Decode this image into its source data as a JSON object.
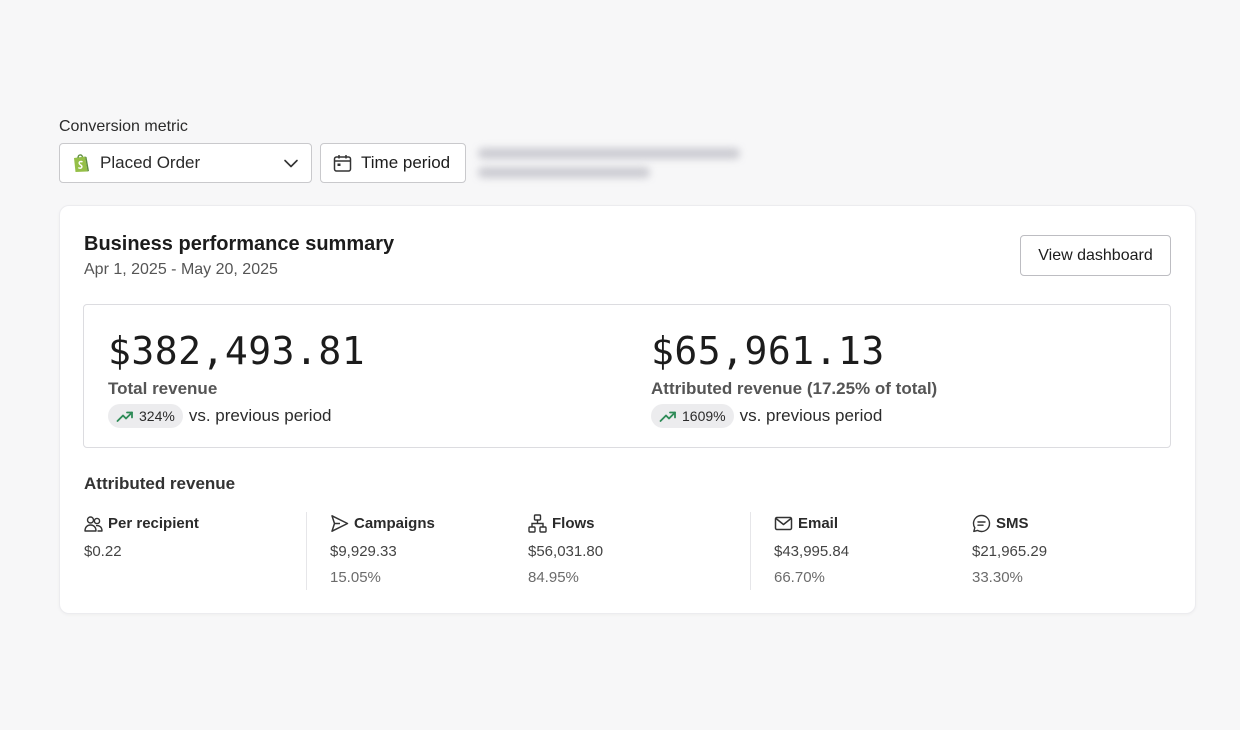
{
  "filters": {
    "label": "Conversion metric",
    "metric_value": "Placed Order",
    "time_period_label": "Time period"
  },
  "summary": {
    "title": "Business performance summary",
    "date_range": "Apr 1, 2025 - May 20, 2025",
    "view_dashboard_label": "View dashboard",
    "total_revenue": {
      "value": "$382,493.81",
      "label": "Total revenue",
      "change": "324%",
      "change_text": "vs. previous period"
    },
    "attributed_revenue": {
      "value": "$65,961.13",
      "label": "Attributed revenue (17.25% of total)",
      "change": "1609%",
      "change_text": "vs. previous period"
    }
  },
  "attributed": {
    "title": "Attributed revenue",
    "per_recipient": {
      "label": "Per recipient",
      "amount": "$0.22",
      "icon": "people-icon"
    },
    "campaigns": {
      "label": "Campaigns",
      "amount": "$9,929.33",
      "pct": "15.05%",
      "icon": "send-icon"
    },
    "flows": {
      "label": "Flows",
      "amount": "$56,031.80",
      "pct": "84.95%",
      "icon": "flow-icon"
    },
    "email": {
      "label": "Email",
      "amount": "$43,995.84",
      "pct": "66.70%",
      "icon": "mail-icon"
    },
    "sms": {
      "label": "SMS",
      "amount": "$21,965.29",
      "pct": "33.30%",
      "icon": "chat-icon"
    }
  },
  "colors": {
    "trend_up": "#2e8b57",
    "shopify_green": "#95bf47"
  }
}
